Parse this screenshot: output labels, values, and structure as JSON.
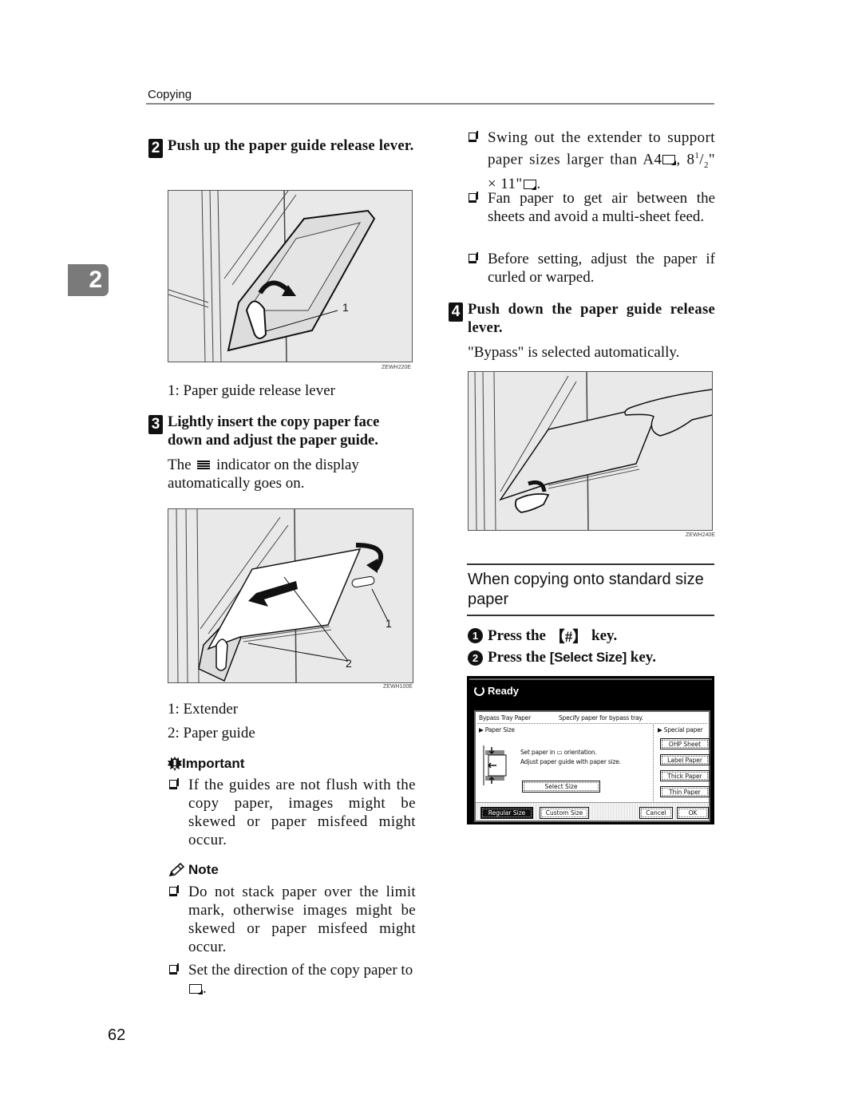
{
  "header": {
    "section": "Copying"
  },
  "chapter_tab": "2",
  "page_number": "62",
  "left_column": {
    "step2": {
      "number": "2",
      "title": "Push up the paper guide release lever."
    },
    "figure1": {
      "code": "ZEWH220E",
      "callouts": [
        "1"
      ]
    },
    "figure1_legend": [
      "1: Paper guide release lever"
    ],
    "step3": {
      "number": "3",
      "title": "Lightly insert the copy paper face down and adjust the paper guide.",
      "body_before_icon": "The",
      "indicator_icon": "paper-stack-indicator-icon",
      "body_after_icon": "indicator on the display automatically goes on."
    },
    "figure2": {
      "code": "ZEWH100E",
      "callouts": [
        "1",
        "2"
      ]
    },
    "figure2_legend": [
      "1: Extender",
      "2: Paper guide"
    ],
    "important": {
      "heading": "Important",
      "items": [
        "If the guides are not flush with the copy paper, images might be skewed or paper misfeed might occur."
      ]
    },
    "note": {
      "heading": "Note",
      "items": [
        "Do not stack paper over the limit mark, otherwise images might be skewed or paper misfeed might occur.",
        "Set the direction of the copy paper to"
      ],
      "item2_suffix": "."
    }
  },
  "right_column": {
    "bullets": [
      {
        "text_a": "Swing out the extender to support paper sizes larger than A4",
        "text_b": ", 8",
        "sup": "1",
        "text_c": "/",
        "sub": "2",
        "text_d": "\" × 11\"",
        "text_e": "."
      },
      {
        "text": "Fan paper to get air between the sheets and avoid a multi-sheet feed."
      },
      {
        "text": "Before setting, adjust the paper if curled or warped."
      }
    ],
    "step4": {
      "number": "4",
      "title": "Push down the paper guide release lever.",
      "body": "\"Bypass\" is selected automatically."
    },
    "figure3": {
      "code": "ZEWH240E"
    },
    "section": {
      "title": "When copying onto standard size paper",
      "substeps": [
        {
          "number": "1",
          "prefix": "Press the",
          "key": "【#】",
          "suffix": "key."
        },
        {
          "number": "2",
          "prefix": "Press the",
          "key": "[Select Size]",
          "suffix": "key."
        }
      ]
    },
    "lcd": {
      "status": "Ready",
      "title": "Bypass Tray Paper",
      "instruction": "Specify paper for bypass tray.",
      "paper_size_label": "Paper Size",
      "special_paper_label": "Special paper",
      "message_line1": "Set paper in ▭ orientation.",
      "message_line2": "Adjust paper guide with paper size.",
      "select_size_button": "Select Size",
      "special_buttons": [
        "OHP Sheet",
        "Label Paper",
        "Thick Paper",
        "Thin Paper"
      ],
      "tabs": [
        "Regular Size",
        "Custom Size"
      ],
      "active_tab": "Regular Size",
      "cancel_button": "Cancel",
      "ok_button": "OK"
    }
  }
}
